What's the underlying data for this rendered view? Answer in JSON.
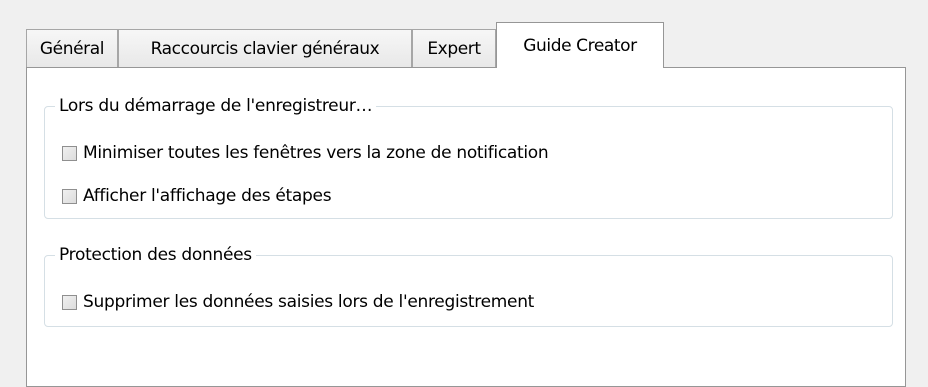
{
  "tabs": [
    {
      "label": "Général",
      "active": false
    },
    {
      "label": "Raccourcis clavier généraux",
      "active": false
    },
    {
      "label": "Expert",
      "active": false
    },
    {
      "label": "Guide Creator",
      "active": true
    }
  ],
  "groups": {
    "recorder_start": {
      "title": "Lors du démarrage de l'enregistreur…",
      "options": [
        {
          "label": "Minimiser toutes les fenêtres vers la zone de notification",
          "checked": false
        },
        {
          "label": "Afficher l'affichage des étapes",
          "checked": false
        }
      ]
    },
    "data_protection": {
      "title": "Protection des données",
      "options": [
        {
          "label": "Supprimer les données saisies lors de l'enregistrement",
          "checked": false
        }
      ]
    }
  }
}
